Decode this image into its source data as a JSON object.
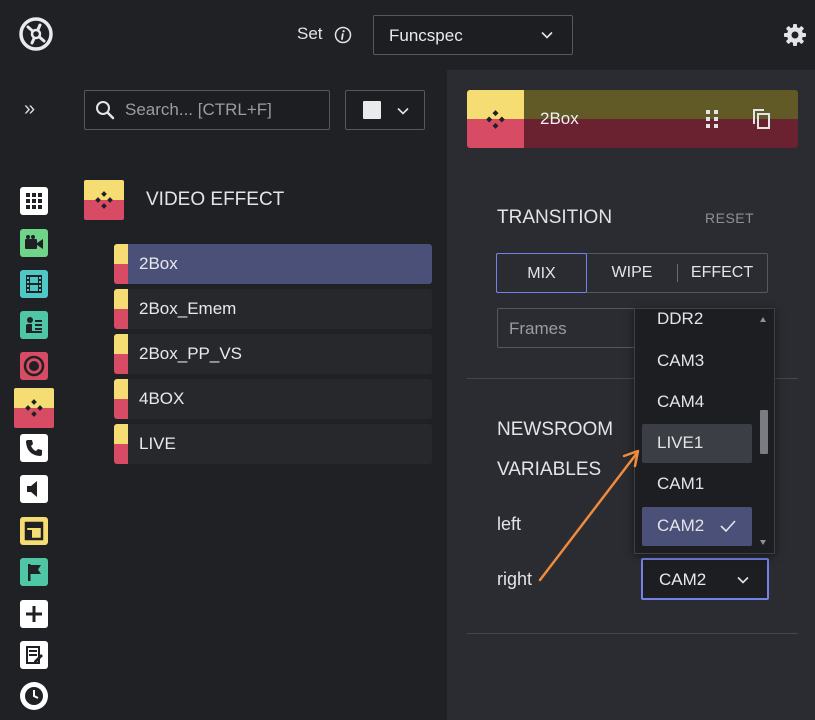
{
  "topbar": {
    "set_label": "Set",
    "set_value": "Funcspec",
    "logo_icon": "app-logo-icon",
    "settings_icon": "gear-icon"
  },
  "rail": {
    "expand_glyph": "»",
    "items": [
      {
        "name": "grid-icon",
        "color": "#ffffff"
      },
      {
        "name": "camera-icon",
        "color": "#6fd48a"
      },
      {
        "name": "film-icon",
        "color": "#4fc7c4"
      },
      {
        "name": "presenter-icon",
        "color": "#4fc7a6"
      },
      {
        "name": "record-icon",
        "color": "#d84b64"
      },
      {
        "name": "video-effect-icon",
        "color": "#f5dd73"
      },
      {
        "name": "phone-icon",
        "color": "#ffffff"
      },
      {
        "name": "speaker-icon",
        "color": "#ffffff"
      },
      {
        "name": "layout-icon",
        "color": "#f5dd73"
      },
      {
        "name": "flag-icon",
        "color": "#4fc7a6"
      },
      {
        "name": "add-icon",
        "color": "#ffffff"
      },
      {
        "name": "edit-list-icon",
        "color": "#ffffff"
      },
      {
        "name": "clock-icon",
        "color": "#ffffff"
      }
    ]
  },
  "search": {
    "placeholder": "Search... [CTRL+F]"
  },
  "category": {
    "title": "VIDEO EFFECT",
    "items": [
      {
        "label": "2Box",
        "selected": true
      },
      {
        "label": "2Box_Emem",
        "selected": false
      },
      {
        "label": "2Box_PP_VS",
        "selected": false
      },
      {
        "label": "4BOX",
        "selected": false
      },
      {
        "label": "LIVE",
        "selected": false
      }
    ]
  },
  "panel": {
    "title": "2Box",
    "transition_title": "TRANSITION",
    "reset_label": "RESET",
    "transition_options": [
      "MIX",
      "WIPE",
      "EFFECT"
    ],
    "selected_transition": "MIX",
    "frames_placeholder": "Frames",
    "newsroom_title_line1": "NEWSROOM",
    "newsroom_title_line2": "VARIABLES",
    "left_label": "left",
    "right_label": "right",
    "right_value": "CAM2"
  },
  "dropdown": {
    "options": [
      "DDR2",
      "CAM3",
      "CAM4",
      "LIVE1",
      "CAM1",
      "CAM2"
    ],
    "hovered": "LIVE1",
    "selected": "CAM2"
  },
  "colors": {
    "accent": "#7282e8",
    "selected_bg": "#4b5078",
    "video_effect_yellow": "#f5dd73",
    "video_effect_red": "#d84b64",
    "annotation_arrow": "#f08a3c"
  }
}
